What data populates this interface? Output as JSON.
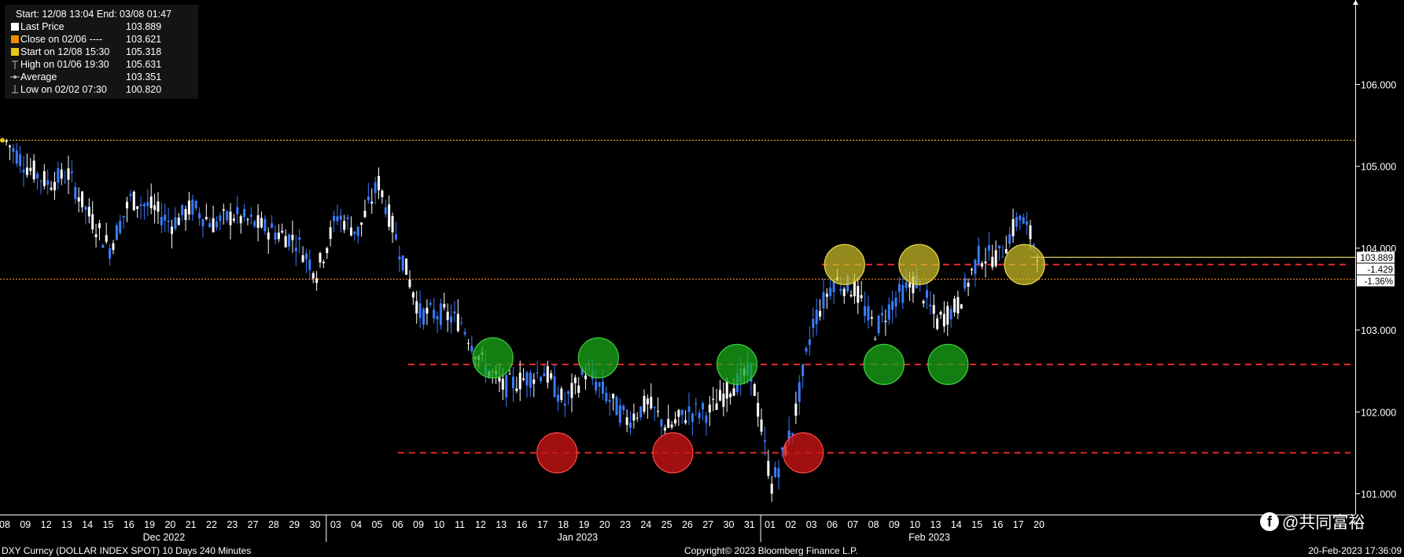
{
  "legend": {
    "header": "Start: 12/08 13:04 End: 03/08 01:47",
    "rows": [
      {
        "label": "Last Price",
        "value": "103.889",
        "color": "#ffffff"
      },
      {
        "label": "Close on 02/06 ----",
        "value": "103.621",
        "color": "#f08c00"
      },
      {
        "label": "Start on 12/08 15:30",
        "value": "105.318",
        "color": "#e6c619"
      },
      {
        "label": "High on 01/06 19:30",
        "value": "105.631",
        "icon": "high-marker-icon"
      },
      {
        "label": "Average",
        "value": "103.351",
        "icon": "average-marker-icon"
      },
      {
        "label": "Low on 02/02 07:30",
        "value": "100.820",
        "icon": "low-marker-icon"
      }
    ]
  },
  "price_tags": {
    "last": "103.889",
    "change": "-1.429",
    "pct": "-1.36%"
  },
  "footer": {
    "left": "DXY Curncy (DOLLAR INDEX SPOT) 10 Days 240 Minutes",
    "center": "Copyright© 2023 Bloomberg Finance L.P.",
    "right": "20-Feb-2023 17:36:09"
  },
  "brand": {
    "text": "@共同富裕"
  },
  "chart_data": {
    "type": "candlestick",
    "ylim": [
      100.8,
      106.7
    ],
    "y_ticks": [
      "106.000",
      "105.000",
      "104.000",
      "103.000",
      "102.000",
      "101.000"
    ],
    "y_tick_values": [
      106,
      105,
      104,
      103,
      102,
      101
    ],
    "day_labels": [
      "08",
      "09",
      "12",
      "13",
      "14",
      "15",
      "16",
      "19",
      "20",
      "21",
      "22",
      "23",
      "27",
      "28",
      "29",
      "30",
      "03",
      "04",
      "05",
      "06",
      "09",
      "10",
      "11",
      "12",
      "13",
      "16",
      "17",
      "18",
      "19",
      "20",
      "23",
      "24",
      "25",
      "26",
      "27",
      "30",
      "31",
      "01",
      "02",
      "03",
      "06",
      "07",
      "08",
      "09",
      "10",
      "13",
      "14",
      "15",
      "16",
      "17",
      "20"
    ],
    "month_labels": [
      {
        "label": "Dec 2022",
        "day_index": 8
      },
      {
        "label": "Jan 2023",
        "day_index": 28
      },
      {
        "label": "Feb 2023",
        "day_index": 45
      }
    ],
    "month_boundaries": [
      16,
      37
    ],
    "reference_lines": {
      "start": 105.318,
      "close": 103.621,
      "last": 103.889
    },
    "support_resistance": [
      {
        "value": 103.8,
        "from_day": 39.5,
        "color": "#e62a2a"
      },
      {
        "value": 102.58,
        "from_day": 19.5,
        "color": "#e62a2a"
      },
      {
        "value": 101.5,
        "from_day": 19.0,
        "color": "#e62a2a"
      }
    ],
    "circles": [
      {
        "day": 23.6,
        "value": 102.66,
        "color": "green"
      },
      {
        "day": 28.7,
        "value": 102.66,
        "color": "green"
      },
      {
        "day": 35.4,
        "value": 102.58,
        "color": "green"
      },
      {
        "day": 42.5,
        "value": 102.58,
        "color": "green"
      },
      {
        "day": 45.6,
        "value": 102.58,
        "color": "green"
      },
      {
        "day": 26.7,
        "value": 101.5,
        "color": "red"
      },
      {
        "day": 32.3,
        "value": 101.5,
        "color": "red"
      },
      {
        "day": 38.6,
        "value": 101.5,
        "color": "red"
      },
      {
        "day": 40.6,
        "value": 103.8,
        "color": "yellow"
      },
      {
        "day": 44.2,
        "value": 103.8,
        "color": "yellow"
      },
      {
        "day": 49.3,
        "value": 103.8,
        "color": "yellow"
      }
    ],
    "daily_path": [
      105.3,
      105.0,
      104.8,
      104.9,
      104.4,
      104.0,
      104.6,
      104.5,
      104.3,
      104.5,
      104.3,
      104.4,
      104.3,
      104.2,
      104.1,
      103.7,
      104.4,
      104.2,
      104.8,
      104.0,
      103.2,
      103.2,
      103.1,
      102.6,
      102.3,
      102.4,
      102.5,
      102.1,
      102.5,
      102.2,
      101.9,
      102.1,
      101.8,
      102.0,
      102.0,
      102.3,
      102.5,
      101.1,
      101.8,
      103.1,
      103.6,
      103.5,
      103.0,
      103.4,
      103.6,
      103.1,
      103.3,
      103.9,
      103.9,
      104.4,
      103.9
    ]
  }
}
